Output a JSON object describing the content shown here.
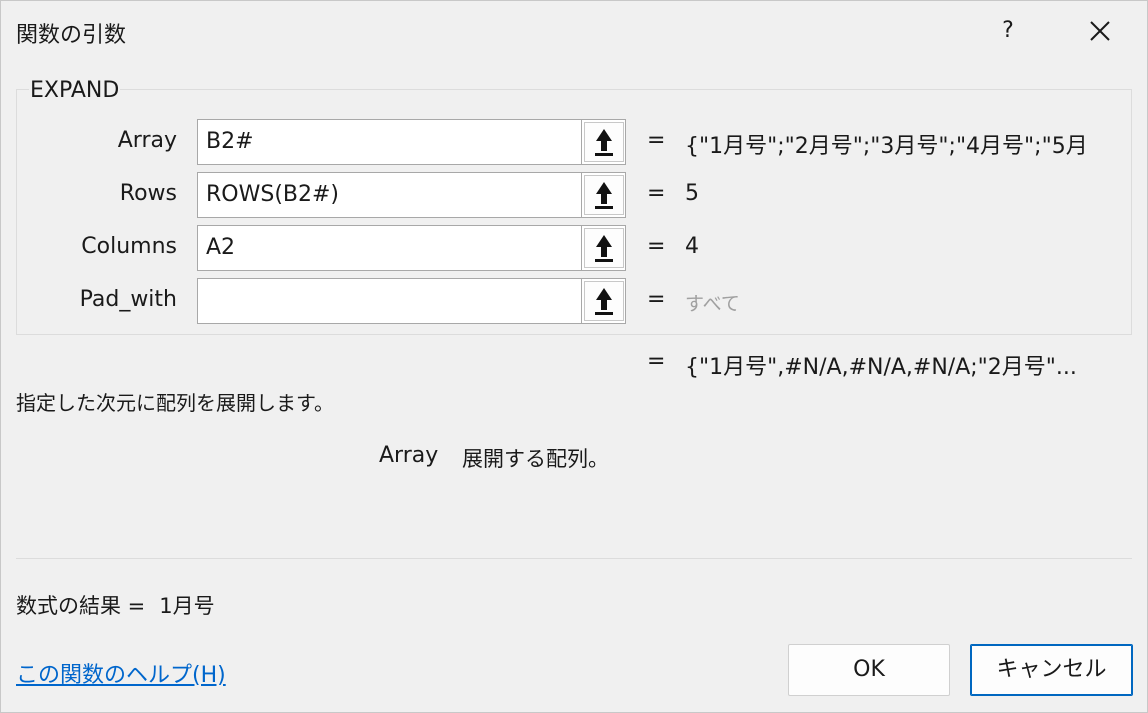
{
  "window": {
    "title": "関数の引数",
    "help_label": "?"
  },
  "function": {
    "name": "EXPAND",
    "description": "指定した次元に配列を展開します。"
  },
  "arguments": [
    {
      "label": "Array",
      "value": "B2#",
      "result": "{\"1月号\";\"2月号\";\"3月号\";\"4月号\";\"5月",
      "placeholder": false
    },
    {
      "label": "Rows",
      "value": "ROWS(B2#)",
      "result": "5",
      "placeholder": false
    },
    {
      "label": "Columns",
      "value": "A2",
      "result": "4",
      "placeholder": false
    },
    {
      "label": "Pad_with",
      "value": "",
      "result": "すべて",
      "placeholder": true
    }
  ],
  "equals": "=",
  "function_result": "{\"1月号\",#N/A,#N/A,#N/A;\"2月号\"...",
  "arg_help": {
    "name": "Array",
    "text": "展開する配列。"
  },
  "formula_result": {
    "label": "数式の結果 =",
    "value": "1月号"
  },
  "help_link": "この関数のヘルプ(H)",
  "buttons": {
    "ok": "OK",
    "cancel": "キャンセル"
  }
}
